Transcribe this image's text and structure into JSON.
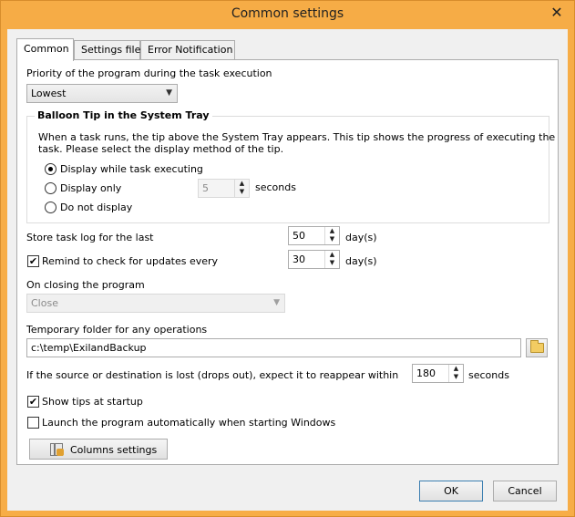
{
  "window": {
    "title": "Common settings",
    "close_glyph": "✕"
  },
  "tabs": [
    {
      "label": "Common",
      "active": true
    },
    {
      "label": "Settings file",
      "active": false
    },
    {
      "label": "Error Notification",
      "active": false
    }
  ],
  "priority": {
    "label": "Priority of the program during the task execution",
    "value": "Lowest"
  },
  "balloon": {
    "title": "Balloon Tip in the System Tray",
    "description_line1": "When a task runs, the tip above the System Tray appears. This tip shows the progress of executing the",
    "description_line2": "task. Please select the display method of the tip.",
    "options": [
      {
        "label": "Display while task executing",
        "selected": true
      },
      {
        "label": "Display only",
        "selected": false
      },
      {
        "label": "Do not display",
        "selected": false
      }
    ],
    "seconds_value": "5",
    "seconds_label": "seconds"
  },
  "log": {
    "label": "Store task log for the last",
    "value": "50",
    "unit": "day(s)"
  },
  "updates": {
    "label": "Remind to check for updates every",
    "checked": true,
    "value": "30",
    "unit": "day(s)"
  },
  "closing": {
    "label": "On closing the program",
    "value": "Close"
  },
  "temp": {
    "label": "Temporary folder for any operations",
    "value": "c:\\temp\\ExilandBackup"
  },
  "reappear": {
    "label": "If the source or destination is lost (drops out), expect it to reappear within",
    "value": "180",
    "unit": "seconds"
  },
  "tips": {
    "label": "Show tips at startup",
    "checked": true
  },
  "autostart": {
    "label": "Launch the program automatically when starting Windows",
    "checked": false
  },
  "columns_button": {
    "label": "Columns settings"
  },
  "footer": {
    "ok": "OK",
    "cancel": "Cancel"
  },
  "glyphs": {
    "check": "✔",
    "up": "▲",
    "down": "▼",
    "dropdown": "▼"
  }
}
